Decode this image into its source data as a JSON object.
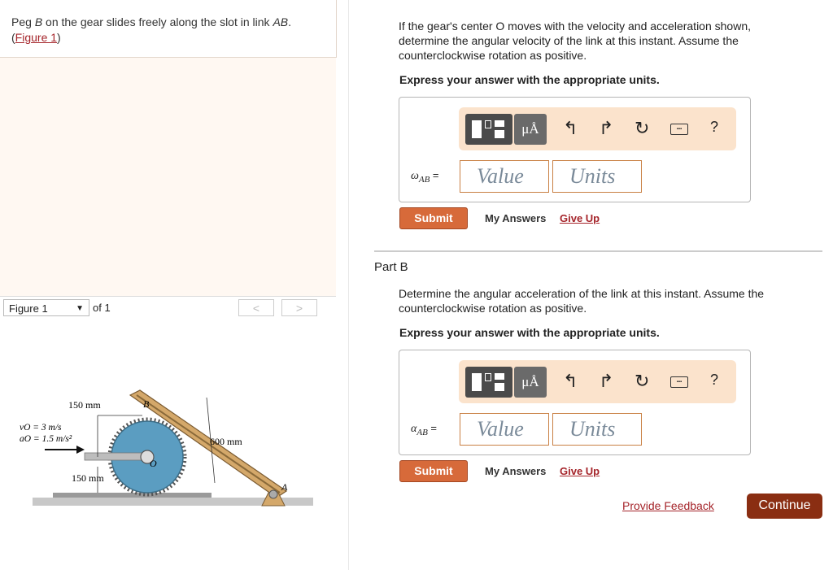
{
  "problem": {
    "statement_part1": "Peg ",
    "statement_peg": "B",
    "statement_part2": " on the gear slides freely along the slot in link ",
    "statement_link": "AB",
    "statement_end": ".",
    "figure_link": "Figure 1"
  },
  "figure_nav": {
    "selected": "Figure 1",
    "of_label": "of 1",
    "prev": "<",
    "next": ">"
  },
  "figure": {
    "label_150_top": "150 mm",
    "label_vo": "vO = 3 m/s",
    "label_ao": "aO = 1.5 m/s²",
    "label_600": "600 mm",
    "label_150_bottom": "150 mm",
    "label_B": "B",
    "label_O": "O",
    "label_A": "A"
  },
  "partA": {
    "question": "If the gear's center O moves with the velocity and acceleration shown, determine the angular velocity of the link at this instant. Assume the counterclockwise rotation as positive.",
    "instruction": "Express your answer with the appropriate units.",
    "variable": "ω",
    "variable_sub": "AB",
    "equals": "=",
    "value_placeholder": "Value",
    "units_placeholder": "Units",
    "submit": "Submit",
    "my_answers": "My Answers",
    "give_up": "Give Up"
  },
  "partB": {
    "title": "Part B",
    "question": "Determine the angular acceleration of the link at this instant. Assume the counterclockwise rotation as positive.",
    "instruction": "Express your answer with the appropriate units.",
    "variable": "α",
    "variable_sub": "AB",
    "equals": "=",
    "value_placeholder": "Value",
    "units_placeholder": "Units",
    "submit": "Submit",
    "my_answers": "My Answers",
    "give_up": "Give Up"
  },
  "toolbar": {
    "mu_label": "μÅ",
    "help": "?",
    "icons": [
      "templates-icon",
      "units-icon",
      "undo-icon",
      "redo-icon",
      "reset-icon",
      "keyboard-icon",
      "help-icon"
    ]
  },
  "footer": {
    "feedback": "Provide Feedback",
    "continue": "Continue"
  },
  "colors": {
    "accent_orange": "#d76a3a",
    "link_red": "#a5242a",
    "continue_bg": "#8a2e12",
    "toolbar_bg": "#fbe3cc",
    "gear_blue": "#5b9dc1"
  }
}
